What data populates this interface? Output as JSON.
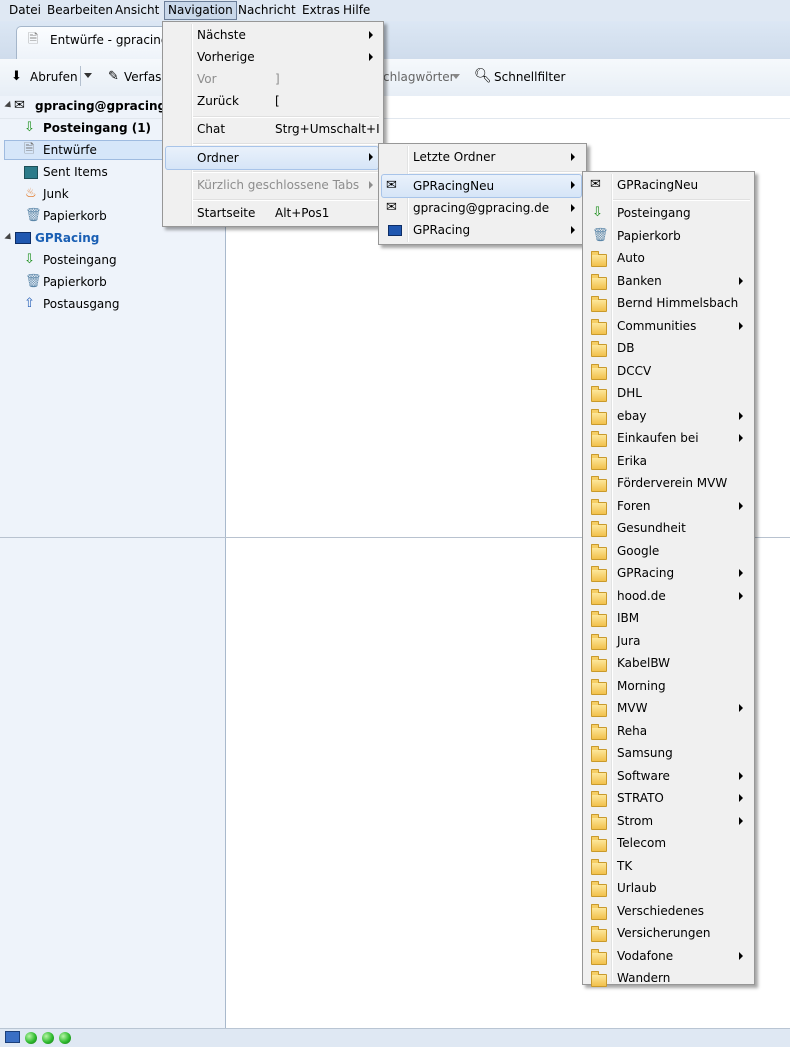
{
  "menubar": {
    "items": [
      "Datei",
      "Bearbeiten",
      "Ansicht",
      "Navigation",
      "Nachricht",
      "Extras",
      "Hilfe"
    ]
  },
  "tab": {
    "label": "Entwürfe - gpracing@"
  },
  "toolbar": {
    "fetch_label": "Abrufen",
    "compose_label": "Verfass",
    "tags_label": "chlagwörter",
    "quickfilter_label": "Schnellfilter"
  },
  "folders": {
    "account1": "gpracing@gpracing.de",
    "account1_items": [
      "Posteingang (1)",
      "Entwürfe",
      "Sent Items",
      "Junk",
      "Papierkorb"
    ],
    "account2": "GPRacing",
    "account2_items": [
      "Posteingang",
      "Papierkorb",
      "Postausgang"
    ]
  },
  "navigation_menu": {
    "items": [
      {
        "label": "Nächste",
        "shortcut": "",
        "submenu": true,
        "disabled": false
      },
      {
        "label": "Vorherige",
        "shortcut": "",
        "submenu": true,
        "disabled": false
      },
      {
        "label": "Vor",
        "shortcut": "]",
        "submenu": false,
        "disabled": true
      },
      {
        "label": "Zurück",
        "shortcut": "[",
        "submenu": false,
        "disabled": false
      },
      {
        "label": "Chat",
        "shortcut": "Strg+Umschalt+I",
        "submenu": false,
        "disabled": false
      },
      {
        "label": "Ordner",
        "shortcut": "",
        "submenu": true,
        "disabled": false
      },
      {
        "label": "Kürzlich geschlossene Tabs",
        "shortcut": "",
        "submenu": true,
        "disabled": true
      },
      {
        "label": "Startseite",
        "shortcut": "Alt+Pos1",
        "submenu": false,
        "disabled": false
      }
    ]
  },
  "ordner_menu": {
    "items": [
      "Letzte Ordner",
      "GPRacingNeu",
      "gpracing@gpracing.de",
      "GPRacing"
    ]
  },
  "gpracingneu_menu": {
    "header": "GPRacingNeu",
    "items": [
      {
        "label": "Posteingang",
        "submenu": false
      },
      {
        "label": "Papierkorb",
        "submenu": false
      },
      {
        "label": "Auto",
        "submenu": false
      },
      {
        "label": "Banken",
        "submenu": true
      },
      {
        "label": "Bernd Himmelsbach",
        "submenu": false
      },
      {
        "label": "Communities",
        "submenu": true
      },
      {
        "label": "DB",
        "submenu": false
      },
      {
        "label": "DCCV",
        "submenu": false
      },
      {
        "label": "DHL",
        "submenu": false
      },
      {
        "label": "ebay",
        "submenu": true
      },
      {
        "label": "Einkaufen bei",
        "submenu": true
      },
      {
        "label": "Erika",
        "submenu": false
      },
      {
        "label": "Förderverein MVW",
        "submenu": false
      },
      {
        "label": "Foren",
        "submenu": true
      },
      {
        "label": "Gesundheit",
        "submenu": false
      },
      {
        "label": "Google",
        "submenu": false
      },
      {
        "label": "GPRacing",
        "submenu": true
      },
      {
        "label": "hood.de",
        "submenu": true
      },
      {
        "label": "IBM",
        "submenu": false
      },
      {
        "label": "Jura",
        "submenu": false
      },
      {
        "label": "KabelBW",
        "submenu": false
      },
      {
        "label": "Morning",
        "submenu": false
      },
      {
        "label": "MVW",
        "submenu": true
      },
      {
        "label": "Reha",
        "submenu": false
      },
      {
        "label": "Samsung",
        "submenu": false
      },
      {
        "label": "Software",
        "submenu": true
      },
      {
        "label": "STRATO",
        "submenu": true
      },
      {
        "label": "Strom",
        "submenu": true
      },
      {
        "label": "Telecom",
        "submenu": false
      },
      {
        "label": "TK",
        "submenu": false
      },
      {
        "label": "Urlaub",
        "submenu": false
      },
      {
        "label": "Verschiedenes",
        "submenu": false
      },
      {
        "label": "Versicherungen",
        "submenu": false
      },
      {
        "label": "Vodafone",
        "submenu": true
      },
      {
        "label": "Wandern",
        "submenu": false
      }
    ]
  },
  "colors": {
    "menubar_bg": "#dfe8f3",
    "highlight": "#d6e5f7",
    "folder_yellow": "#f2c04b",
    "status_green": "#2fbb2f",
    "account_blue": "#1a5fb4"
  }
}
